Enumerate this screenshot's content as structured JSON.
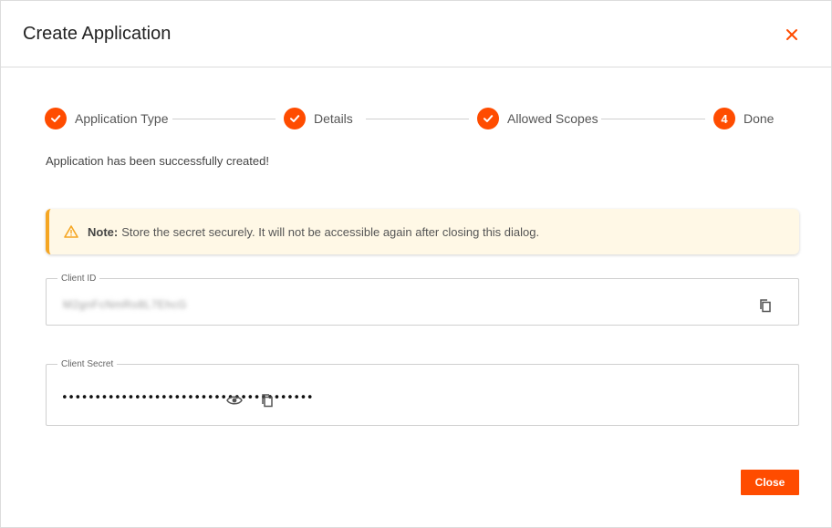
{
  "dialog": {
    "title": "Create Application",
    "close_icon": "close-icon"
  },
  "stepper": {
    "steps": [
      {
        "label": "Application Type",
        "state": "completed",
        "icon": "check-icon"
      },
      {
        "label": "Details",
        "state": "completed",
        "icon": "check-icon"
      },
      {
        "label": "Allowed Scopes",
        "state": "completed",
        "icon": "check-icon"
      },
      {
        "label": "Done",
        "state": "active",
        "number": "4"
      }
    ]
  },
  "success_message": "Application has been successfully created!",
  "note": {
    "icon": "warning-icon",
    "prefix": "Note:",
    "text": "Store the secret securely. It will not be accessible again after closing this dialog."
  },
  "client_id": {
    "label": "Client ID",
    "value": "M2gnFcNmRo8L7EhcG",
    "copy_icon": "copy-icon"
  },
  "client_secret": {
    "label": "Client Secret",
    "masked_value": "••••••••••••••••••••••••••••••••••••••",
    "visibility_icon": "eye-icon",
    "copy_icon": "copy-icon"
  },
  "footer": {
    "close_label": "Close"
  },
  "colors": {
    "accent": "#ff4c00",
    "note_bg": "#fff8e6",
    "note_border": "#f5a623"
  }
}
